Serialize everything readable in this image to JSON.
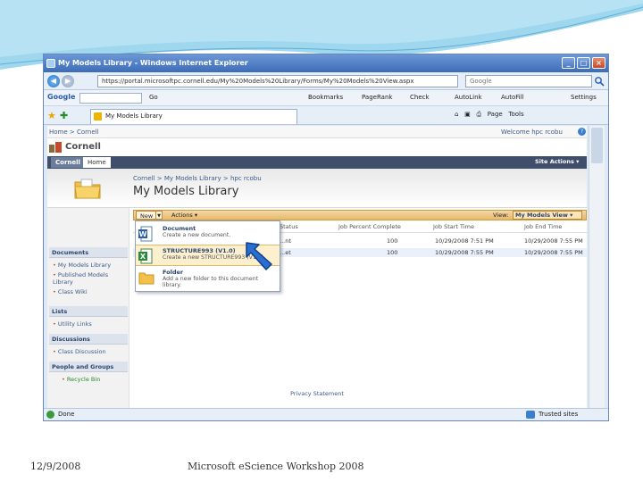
{
  "slide": {
    "footer_date": "12/9/2008",
    "footer_title": "Microsoft eScience Workshop 2008",
    "colors": {
      "wave": "#7ec9e8",
      "accent": "#3b5a8a"
    }
  },
  "browser": {
    "title": "My Models Library - Windows Internet Explorer",
    "url": "https://portal.microsoftpc.cornell.edu/My%20Models%20Library/Forms/My%20Models%20View.aspx",
    "search_placeholder": "Google",
    "google": {
      "logo": "Google",
      "items": [
        "Go",
        "Bookmarks",
        "PageRank",
        "Check",
        "AutoLink",
        "AutoFill",
        "Settings"
      ]
    },
    "tab_label": "My Models Library",
    "tools": [
      "Page",
      "Tools"
    ],
    "status_text": "Done",
    "status_zone": "Trusted sites"
  },
  "sharepoint": {
    "top_breadcrumb": "Home > Cornell",
    "welcome": "Welcome hpc rcobu",
    "site_title": "Cornell",
    "nav_tabs": [
      "Cornell",
      "Home"
    ],
    "site_actions": "Site Actions",
    "lib_breadcrumb": "Cornell > My Models Library > hpc rcobu",
    "lib_title": "My Models Library",
    "quicklaunch": {
      "documents_head": "Documents",
      "documents": [
        "My Models Library",
        "Published Models Library",
        "Class Wiki"
      ],
      "lists_head": "Lists",
      "lists": [
        "Utility Links"
      ],
      "discussions_head": "Discussions",
      "discussions": [
        "Class Discussion"
      ],
      "people_head": "People and Groups",
      "recycle": "Recycle Bin"
    },
    "toolbar": {
      "new": "New",
      "actions": "Actions",
      "view_label": "View:",
      "view_value": "My Models View"
    },
    "columns": [
      "Status",
      "Job Percent Complete",
      "Job Start Time",
      "Job End Time"
    ],
    "rows": [
      {
        "status": "...nt",
        "pct": "100",
        "start": "10/29/2008 7:51 PM",
        "end": "10/29/2008 7:55 PM"
      },
      {
        "status": "...et",
        "pct": "100",
        "start": "10/29/2008 7:55 PM",
        "end": "10/29/2008 7:55 PM"
      }
    ],
    "new_menu": [
      {
        "title": "Document",
        "desc": "Create a new document."
      },
      {
        "title": "STRUCTURE993 (V1.0)",
        "desc": "Create a new STRUCTURE993 (V1.0)"
      },
      {
        "title": "Folder",
        "desc": "Add a new folder to this document library."
      }
    ],
    "privacy": "Privacy Statement"
  }
}
